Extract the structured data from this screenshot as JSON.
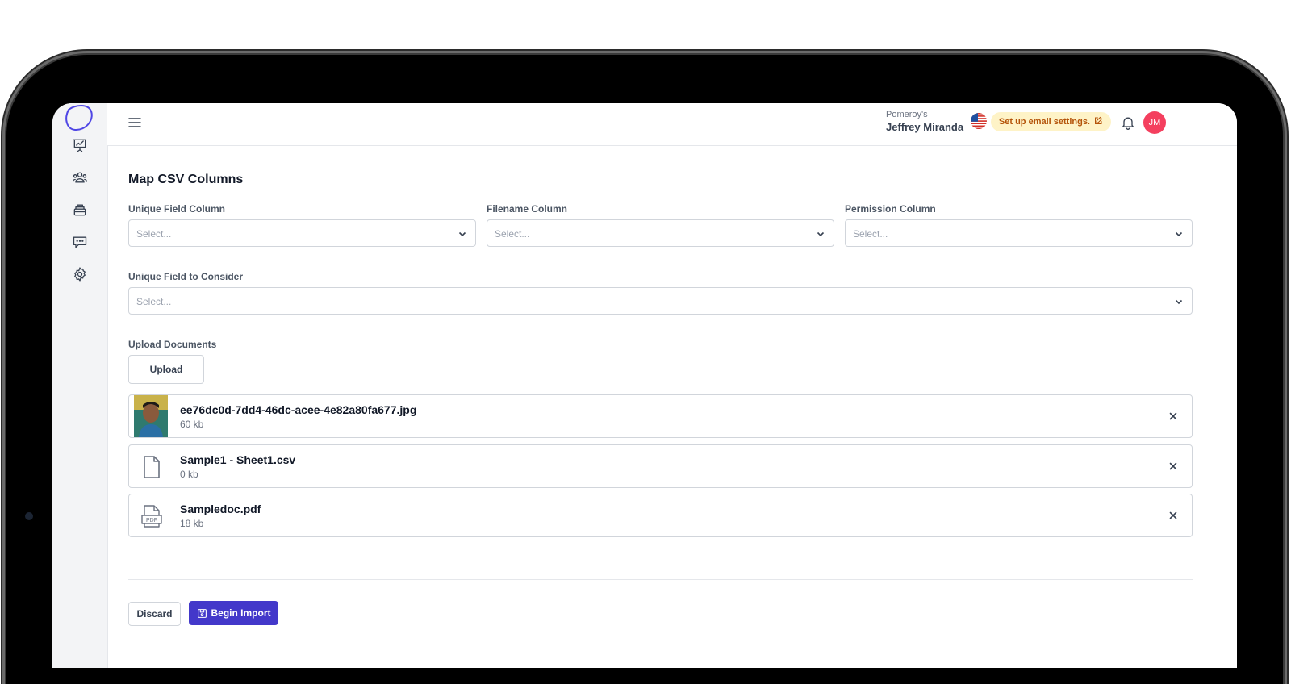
{
  "header": {
    "email_settings_label": "Set up email settings.",
    "user": {
      "initials": "JM",
      "org": "Pomeroy's",
      "name": "Jeffrey Miranda"
    }
  },
  "sidebar": {
    "icons": [
      "presentation-chart-icon",
      "users-group-icon",
      "archive-stack-icon",
      "chat-bubble-icon",
      "settings-gear-icon"
    ]
  },
  "main": {
    "title": "Map CSV Columns",
    "fields": {
      "unique_field_column": {
        "label": "Unique Field Column",
        "placeholder": "Select..."
      },
      "filename_column": {
        "label": "Filename Column",
        "placeholder": "Select..."
      },
      "permission_column": {
        "label": "Permission Column",
        "placeholder": "Select..."
      },
      "unique_field_to_consider": {
        "label": "Unique Field to Consider",
        "placeholder": "Select..."
      }
    },
    "upload": {
      "label": "Upload Documents",
      "button": "Upload"
    },
    "files": [
      {
        "name": "ee76dc0d-7dd4-46dc-acee-4e82a80fa677.jpg",
        "size": "60 kb",
        "type": "image"
      },
      {
        "name": "Sample1 - Sheet1.csv",
        "size": "0 kb",
        "type": "document"
      },
      {
        "name": "Sampledoc.pdf",
        "size": "18 kb",
        "type": "pdf"
      }
    ],
    "actions": {
      "discard": "Discard",
      "begin_import": "Begin Import"
    }
  },
  "colors": {
    "primary": "#4338ca",
    "avatar": "#f43f5e",
    "email_pill_bg": "#fef3c7",
    "email_pill_text": "#b45309",
    "logo": "#4f46e5"
  }
}
